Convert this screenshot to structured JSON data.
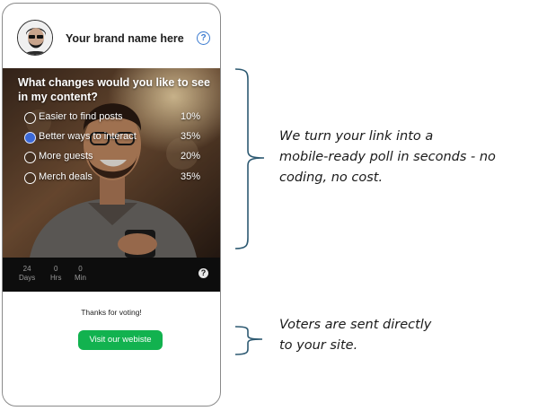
{
  "brand": {
    "name": "Your brand name here",
    "help_symbol": "?"
  },
  "poll": {
    "question": "What changes would you like to see in my content?",
    "options": [
      {
        "label": "Easier to find posts",
        "percent": "10%",
        "selected": false
      },
      {
        "label": "Better ways to interact",
        "percent": "35%",
        "selected": true
      },
      {
        "label": "More guests",
        "percent": "20%",
        "selected": false
      },
      {
        "label": "Merch deals",
        "percent": "35%",
        "selected": false
      }
    ]
  },
  "timer": {
    "days": {
      "value": "24",
      "unit": "Days"
    },
    "hours": {
      "value": "0",
      "unit": "Hrs"
    },
    "minutes": {
      "value": "0",
      "unit": "Min"
    },
    "help_symbol": "?"
  },
  "after_vote": {
    "thanks": "Thanks for voting!",
    "cta_label": "Visit our webiste"
  },
  "annotations": {
    "top_lines": [
      "We turn your link into a",
      "mobile-ready poll in seconds - no",
      "coding, no cost."
    ],
    "bottom_lines": [
      "Voters are sent directly",
      "to your site."
    ]
  },
  "colors": {
    "accent_blue": "#3b7bd0",
    "cta_green": "#12b24f",
    "bracket": "#2e5a72"
  }
}
